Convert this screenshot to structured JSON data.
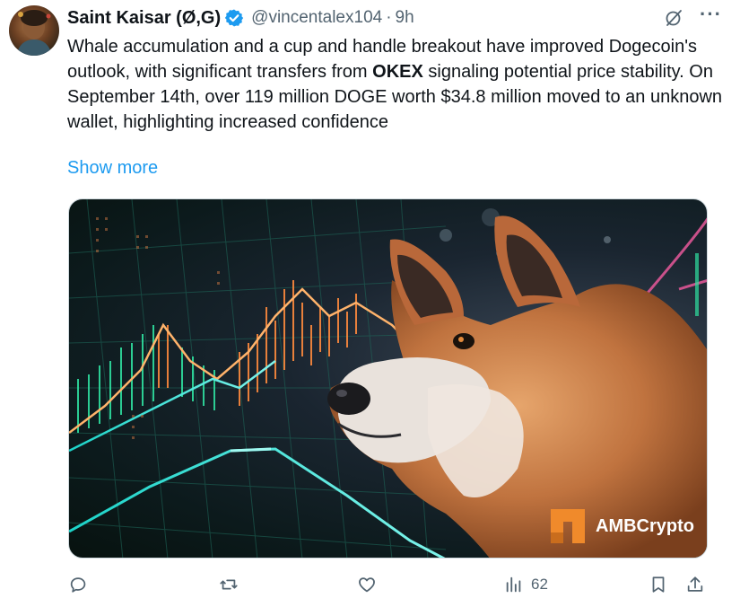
{
  "tweet": {
    "author_name": "Saint Kaisar (Ø,G)",
    "handle": "@vincentalex104",
    "separator": "·",
    "time": "9h",
    "text_part1": "Whale accumulation and a cup and handle breakout have improved Dogecoin's outlook, with significant transfers from ",
    "text_bold": "OKEX",
    "text_part2": " signaling potential price stability. On September 14th, over 119 million DOGE worth $34.8 million moved to an unknown wallet, highlighting increased confidence",
    "show_more": "Show more"
  },
  "media": {
    "watermark": "AMBCrypto"
  },
  "actions": {
    "views": "62"
  },
  "icons": {
    "verified": "verified-badge-icon",
    "grok": "grok-icon",
    "more": "more-icon",
    "reply": "reply-icon",
    "retweet": "retweet-icon",
    "like": "heart-icon",
    "views": "analytics-icon",
    "bookmark": "bookmark-icon",
    "share": "share-icon"
  },
  "colors": {
    "accent": "#1d9bf0",
    "secondary_text": "#536471",
    "brand_orange": "#f08a2b"
  }
}
